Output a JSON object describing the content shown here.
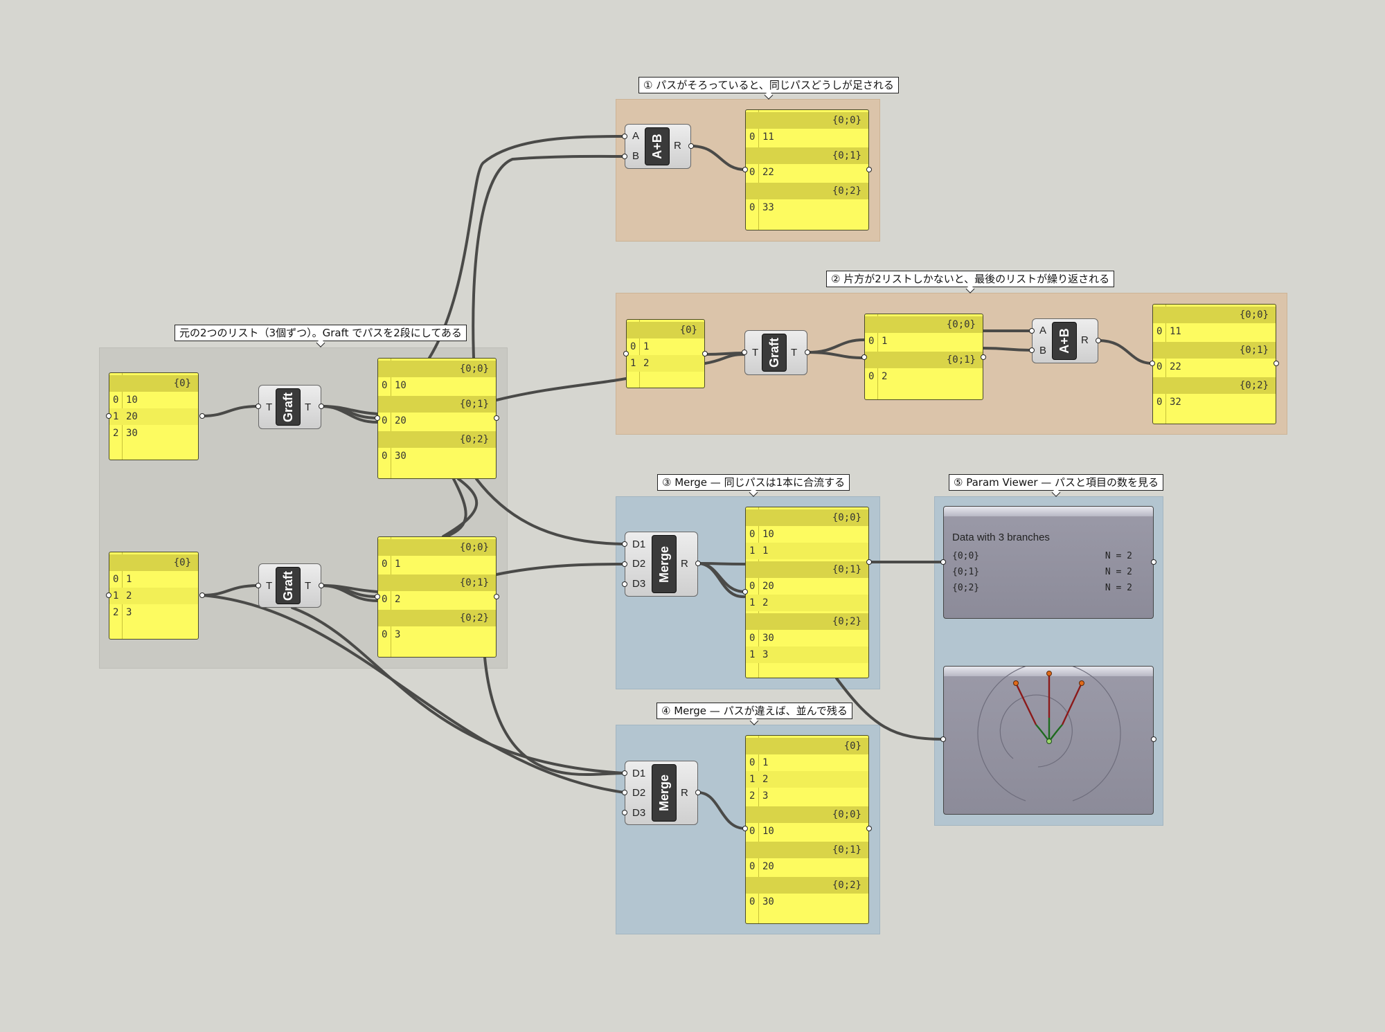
{
  "callouts": {
    "c_graft": "元の2つのリスト（3個ずつ）。Graft でパスを2段にしてある",
    "c1": "① パスがそろっていると、同じパスどうしが足される",
    "c2": "② 片方が2リストしかないと、最後のリストが繰り返される",
    "c3": "③ Merge — 同じパスは1本に合流する",
    "c4": "④ Merge — パスが違えば、並んで残る",
    "c5": "⑤ Param Viewer — パスと項目の数を見る"
  },
  "components": {
    "graft1": {
      "name": "Graft",
      "in": [
        "T"
      ],
      "out": "T"
    },
    "graft2": {
      "name": "Graft",
      "in": [
        "T"
      ],
      "out": "T"
    },
    "graft3": {
      "name": "Graft",
      "in": [
        "T"
      ],
      "out": "T"
    },
    "add1": {
      "name": "A+B",
      "in": [
        "A",
        "B"
      ],
      "out": "R"
    },
    "add2": {
      "name": "A+B",
      "in": [
        "A",
        "B"
      ],
      "out": "R"
    },
    "merge1": {
      "name": "Merge",
      "in": [
        "D1",
        "D2",
        "D3"
      ],
      "out": "R"
    },
    "merge2": {
      "name": "Merge",
      "in": [
        "D1",
        "D2",
        "D3"
      ],
      "out": "R"
    }
  },
  "panels": {
    "p_in1": [
      {
        "path": "{0}",
        "items": [
          [
            "0",
            "10"
          ],
          [
            "1",
            "20"
          ],
          [
            "2",
            "30"
          ]
        ]
      }
    ],
    "p_in2": [
      {
        "path": "{0}",
        "items": [
          [
            "0",
            "1"
          ],
          [
            "1",
            "2"
          ],
          [
            "2",
            "3"
          ]
        ]
      }
    ],
    "p_g1": [
      {
        "path": "{0;0}",
        "items": [
          [
            "0",
            "10"
          ]
        ]
      },
      {
        "path": "{0;1}",
        "items": [
          [
            "0",
            "20"
          ]
        ]
      },
      {
        "path": "{0;2}",
        "items": [
          [
            "0",
            "30"
          ]
        ]
      }
    ],
    "p_g2": [
      {
        "path": "{0;0}",
        "items": [
          [
            "0",
            "1"
          ]
        ]
      },
      {
        "path": "{0;1}",
        "items": [
          [
            "0",
            "2"
          ]
        ]
      },
      {
        "path": "{0;2}",
        "items": [
          [
            "0",
            "3"
          ]
        ]
      }
    ],
    "p_r1": [
      {
        "path": "{0;0}",
        "items": [
          [
            "0",
            "11"
          ]
        ]
      },
      {
        "path": "{0;1}",
        "items": [
          [
            "0",
            "22"
          ]
        ]
      },
      {
        "path": "{0;2}",
        "items": [
          [
            "0",
            "33"
          ]
        ]
      }
    ],
    "p_in3": [
      {
        "path": "{0}",
        "items": [
          [
            "0",
            "1"
          ],
          [
            "1",
            "2"
          ]
        ]
      }
    ],
    "p_g3": [
      {
        "path": "{0;0}",
        "items": [
          [
            "0",
            "1"
          ]
        ]
      },
      {
        "path": "{0;1}",
        "items": [
          [
            "0",
            "2"
          ]
        ]
      }
    ],
    "p_r2": [
      {
        "path": "{0;0}",
        "items": [
          [
            "0",
            "11"
          ]
        ]
      },
      {
        "path": "{0;1}",
        "items": [
          [
            "0",
            "22"
          ]
        ]
      },
      {
        "path": "{0;2}",
        "items": [
          [
            "0",
            "32"
          ]
        ]
      }
    ],
    "p_m1": [
      {
        "path": "{0;0}",
        "items": [
          [
            "0",
            "10"
          ],
          [
            "1",
            "1"
          ]
        ]
      },
      {
        "path": "{0;1}",
        "items": [
          [
            "0",
            "20"
          ],
          [
            "1",
            "2"
          ]
        ]
      },
      {
        "path": "{0;2}",
        "items": [
          [
            "0",
            "30"
          ],
          [
            "1",
            "3"
          ]
        ]
      }
    ],
    "p_m2": [
      {
        "path": "{0}",
        "items": [
          [
            "0",
            "1"
          ],
          [
            "1",
            "2"
          ],
          [
            "2",
            "3"
          ]
        ]
      },
      {
        "path": "{0;0}",
        "items": [
          [
            "0",
            "10"
          ]
        ]
      },
      {
        "path": "{0;1}",
        "items": [
          [
            "0",
            "20"
          ]
        ]
      },
      {
        "path": "{0;2}",
        "items": [
          [
            "0",
            "30"
          ]
        ]
      }
    ]
  },
  "param_viewer": {
    "title": "Data with 3 branches",
    "rows": [
      {
        "path": "{0;0}",
        "count": "N = 2"
      },
      {
        "path": "{0;1}",
        "count": "N = 2"
      },
      {
        "path": "{0;2}",
        "count": "N = 2"
      }
    ]
  },
  "colors": {
    "panel_fill": "#fdfb60",
    "wire": "#4a4a48",
    "tree_red": "#8b1a1a",
    "tree_green": "#1e6a1e",
    "tree_node": "#e06a1a"
  }
}
